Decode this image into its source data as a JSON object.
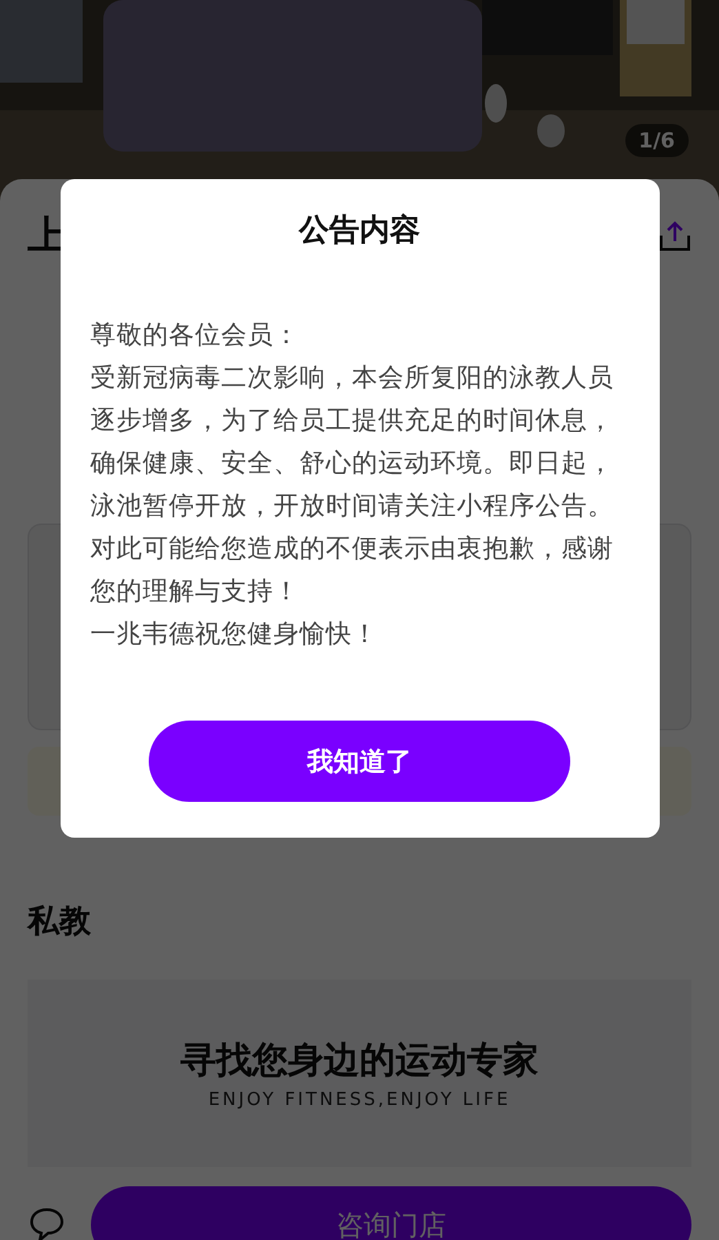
{
  "gallery": {
    "counter": "1/6",
    "kind": "picture"
  },
  "store": {
    "title_fragment": "上"
  },
  "private_coach": {
    "heading": "私教",
    "banner_title": "寻找您身边的运动专家",
    "banner_subtitle": "ENJOY FITNESS,ENJOY LIFE"
  },
  "bottom_bar": {
    "consult_button": "咨询门店"
  },
  "dialog": {
    "title": "公告内容",
    "paragraphs": [
      "尊敬的各位会员：",
      "受新冠病毒二次影响，本会所复阳的泳教人员逐步增多，为了给员工提供充足的时间休息，确保健康、安全、舒心的运动环境。即日起，泳池暂停开放，开放时间请关注小程序公告。对此可能给您造成的不便表示由衷抱歉，感谢您的理解与支持！",
      "一兆韦德祝您健身愉快！"
    ],
    "confirm_button": "我知道了"
  }
}
